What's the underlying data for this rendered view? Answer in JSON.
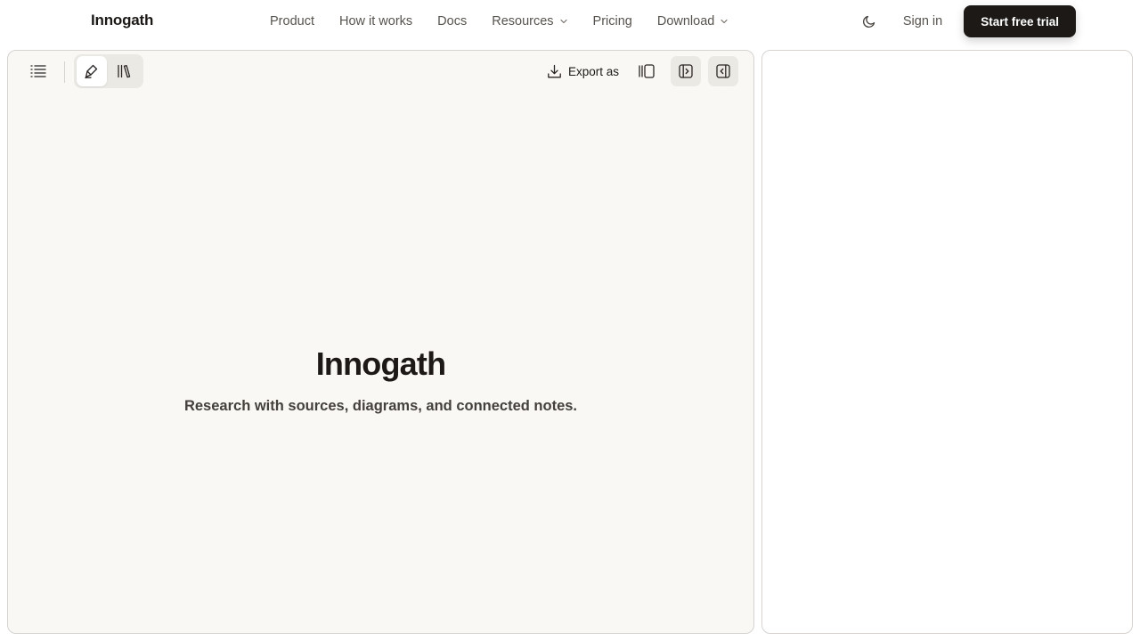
{
  "nav": {
    "brand": "Innogath",
    "links": [
      {
        "label": "Product"
      },
      {
        "label": "How it works"
      },
      {
        "label": "Docs"
      },
      {
        "label": "Resources",
        "has_dropdown": true
      },
      {
        "label": "Pricing"
      },
      {
        "label": "Download",
        "has_dropdown": true
      }
    ],
    "theme_icon": "moon-icon",
    "sign_in": "Sign in",
    "cta": "Start free trial"
  },
  "toolbar": {
    "menu_icon": "list-icon",
    "mode_icons": [
      "pen-edit-icon",
      "library-icon"
    ],
    "active_mode": "pen-edit-icon",
    "export_label": "Export as",
    "export_icon": "download-icon",
    "right_icons": [
      "column-layout-icon",
      "panel-expand-icon",
      "panel-collapse-icon"
    ]
  },
  "hero": {
    "title": "Innogath",
    "subtitle": "Research with sources, diagrams, and connected notes."
  },
  "colors": {
    "panel_bg": "#f9f8f5",
    "cta_bg": "#1c1917",
    "border": "#d6d3d1",
    "muted_text": "#57534e"
  }
}
